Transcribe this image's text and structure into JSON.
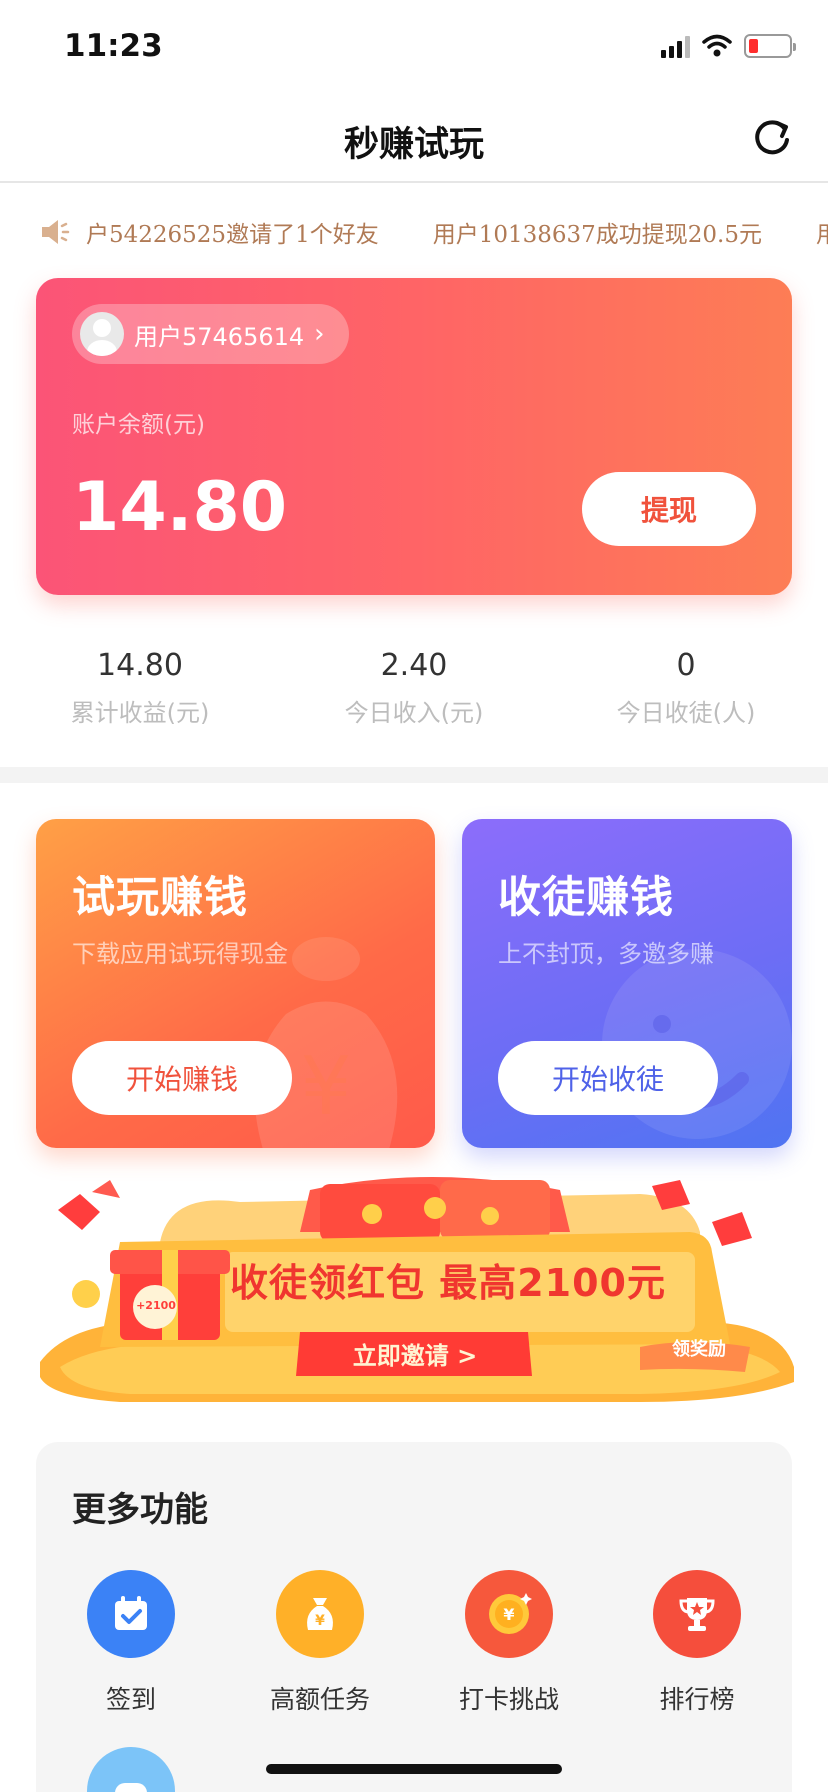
{
  "status_bar": {
    "time": "11:23"
  },
  "nav": {
    "title": "秒赚试玩"
  },
  "ticker": {
    "messages": [
      "户54226525邀请了1个好友",
      "用户10138637成功提现20.5元",
      "用"
    ]
  },
  "balance_card": {
    "username": "用户57465614",
    "balance_label": "账户余额(元)",
    "balance": "14.80",
    "withdraw_label": "提现"
  },
  "stats": [
    {
      "value": "14.80",
      "label": "累计收益(元)"
    },
    {
      "value": "2.40",
      "label": "今日收入(元)"
    },
    {
      "value": "0",
      "label": "今日收徒(人)"
    }
  ],
  "features": {
    "play": {
      "title": "试玩赚钱",
      "subtitle": "下载应用试玩得现金",
      "button": "开始赚钱",
      "deco_glyph": "¥"
    },
    "recruit": {
      "title": "收徒赚钱",
      "subtitle": "上不封顶，多邀多赚",
      "button": "开始收徒"
    }
  },
  "banner": {
    "headline": "收徒领红包 最高2100元",
    "cta": "立即邀请 >",
    "gift_tag": "+2100",
    "corner_tag": "领奖励"
  },
  "more": {
    "title": "更多功能",
    "items": [
      {
        "label": "签到",
        "icon": "calendar-check-icon",
        "color": "#3b82f6"
      },
      {
        "label": "高额任务",
        "icon": "money-bag-icon",
        "color": "#ffb028"
      },
      {
        "label": "打卡挑战",
        "icon": "coin-icon",
        "color": "#f6583c"
      },
      {
        "label": "排行榜",
        "icon": "trophy-icon",
        "color": "#f54e3c"
      },
      {
        "label": "",
        "icon": "game-controller-icon",
        "color": "#7cc4f8"
      }
    ]
  }
}
